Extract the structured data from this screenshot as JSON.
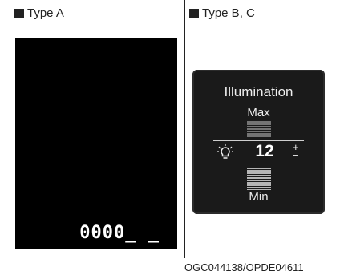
{
  "type_a": {
    "label": "Type A",
    "odometer": "0000_ _"
  },
  "type_b": {
    "label": "Type B, C",
    "title": "Illumination",
    "max_label": "Max",
    "min_label": "Min",
    "level": "12",
    "plus": "+",
    "minus": "−",
    "icon": "bulb-icon"
  },
  "caption": "OGC044138/OPDE04611"
}
